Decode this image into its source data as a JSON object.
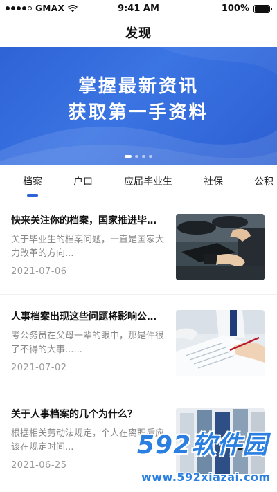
{
  "status_bar": {
    "carrier": "GMAX",
    "time": "9:41 AM",
    "battery": "100%"
  },
  "nav": {
    "title": "发现"
  },
  "banner": {
    "line1": "掌握最新资讯",
    "line2": "获取第一手资料",
    "slide_count": 4,
    "active_slide": 1,
    "background_color": "#2e63d6"
  },
  "tabs": [
    {
      "label": "档案",
      "active": true
    },
    {
      "label": "户口",
      "active": false
    },
    {
      "label": "应届毕业生",
      "active": false
    },
    {
      "label": "社保",
      "active": false
    },
    {
      "label": "公积",
      "active": false
    }
  ],
  "accent_color": "#2e63d6",
  "articles": [
    {
      "title": "快来关注你的档案，国家推进毕…",
      "summary": "关于毕业生的档案问题，一直是国家大力改革的方向...",
      "date": "2021-07-06",
      "image": "graduation-caps-photo"
    },
    {
      "title": "人事档案出现这些问题将影响公…",
      "summary": "考公务员在父母一辈的眼中，那是件很了不得的大事......",
      "date": "2021-07-02",
      "image": "signing-document-photo"
    },
    {
      "title": "关于人事档案的几个为什么？",
      "summary": "根据相关劳动法规定，个人在离职后应该在规定时间...",
      "date": "2021-06-25",
      "image": "binders-photo"
    }
  ],
  "watermark": {
    "logo": "592软件园",
    "url": "www.592xiazai.com"
  }
}
